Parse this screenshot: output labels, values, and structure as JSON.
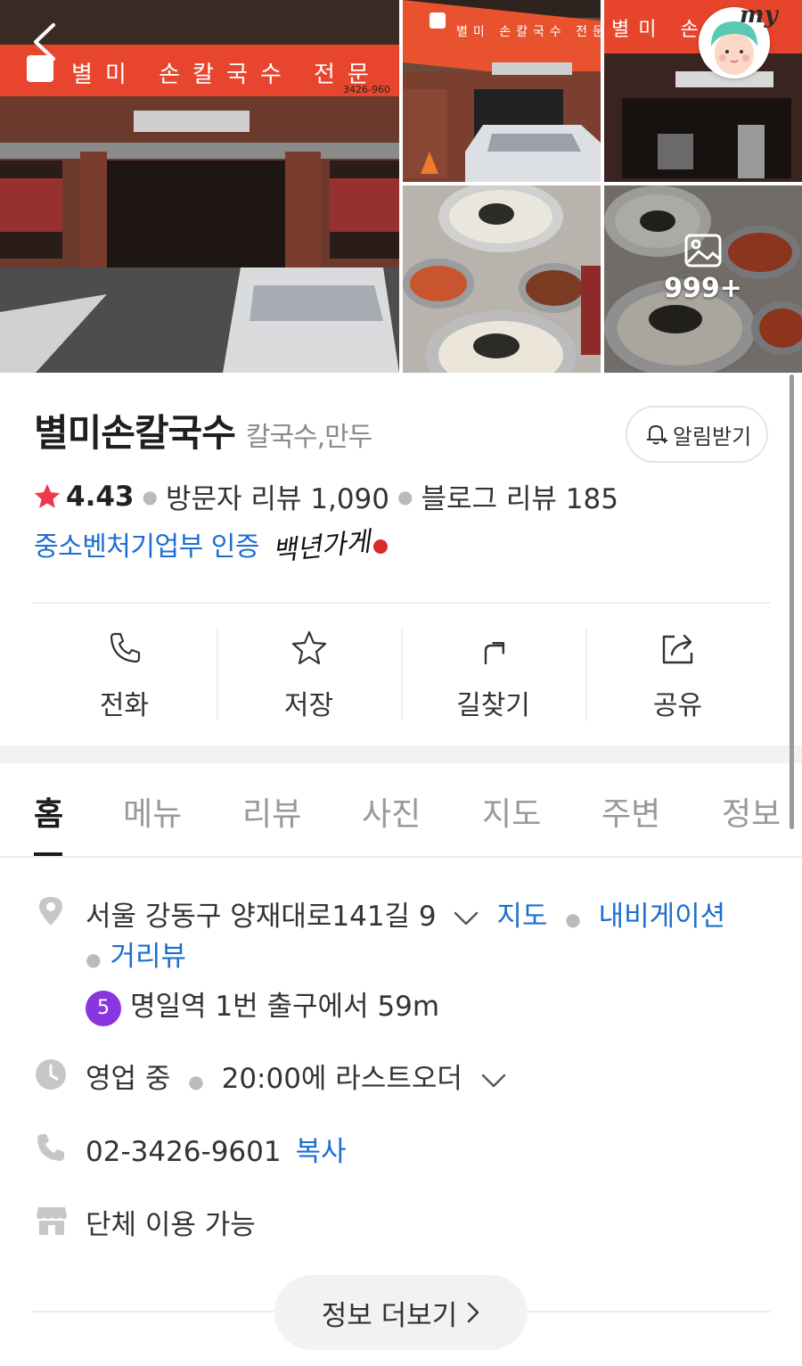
{
  "photos": {
    "main_sign_text": "별미 손칼국수 전문",
    "main_sign_phone": "3426-960",
    "secondary_sign_text": "별미 손칼국수 전문",
    "third_sign_text": "별미 손",
    "photo_count": "999+",
    "my_label": "my"
  },
  "store": {
    "name": "별미손칼국수",
    "category": "칼국수,만두",
    "alarm_label": "알림받기",
    "rating": "4.43",
    "visitor_reviews": "방문자 리뷰 1,090",
    "blog_reviews": "블로그 리뷰 185",
    "cert_text": "중소벤처기업부 인증",
    "cert_signature": "백년가게"
  },
  "actions": [
    {
      "label": "전화",
      "icon": "phone-icon"
    },
    {
      "label": "저장",
      "icon": "star-icon"
    },
    {
      "label": "길찾기",
      "icon": "directions-icon"
    },
    {
      "label": "공유",
      "icon": "share-icon"
    }
  ],
  "tabs": [
    "홈",
    "메뉴",
    "리뷰",
    "사진",
    "지도",
    "주변",
    "정보"
  ],
  "details": {
    "address": "서울 강동구 양재대로141길 9",
    "map_link": "지도",
    "navigation_link": "내비게이션",
    "streetview_link": "거리뷰",
    "subway_line": "5",
    "subway_text": "명일역 1번 출구에서 59m",
    "hours_status": "영업 중",
    "hours_last_order": "20:00에 라스트오더",
    "phone": "02-3426-9601",
    "copy_link": "복사",
    "group_use": "단체 이용 가능",
    "more_info": "정보 더보기"
  },
  "colors": {
    "accent_link": "#1c6fd1",
    "star": "#f0384b",
    "subway_line5": "#8936e0"
  }
}
